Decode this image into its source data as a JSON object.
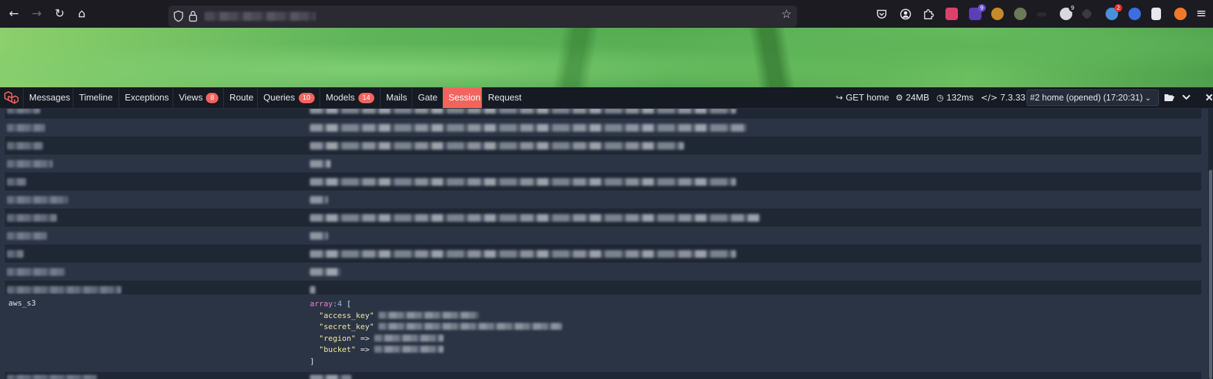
{
  "browser": {
    "back_icon": "←",
    "forward_icon": "→",
    "reload_icon": "↻",
    "home_icon": "⌂",
    "bookmark_icon": "☆",
    "menu_icon": "≡",
    "extension_badges": [
      "9",
      "9",
      "2"
    ]
  },
  "debugbar": {
    "tabs": [
      {
        "label": "Messages"
      },
      {
        "label": "Timeline"
      },
      {
        "label": "Exceptions"
      },
      {
        "label": "Views",
        "badge": "8"
      },
      {
        "label": "Route"
      },
      {
        "label": "Queries",
        "badge": "10"
      },
      {
        "label": "Models",
        "badge": "14"
      },
      {
        "label": "Mails"
      },
      {
        "label": "Gate"
      },
      {
        "label": "Session"
      },
      {
        "label": "Request"
      }
    ],
    "active_tab": "Session",
    "route": "GET home",
    "memory": "24MB",
    "duration": "132ms",
    "php_version": "7.3.33",
    "dataset": "#2 home (opened) (17:20:31)",
    "colors": {
      "accent": "#f4645f",
      "bar_bg": "#161a23",
      "panel_bg": "#2b3444",
      "row_alt": "#1f2634"
    }
  },
  "session": {
    "aws_key": "aws_s3",
    "dump": {
      "type": "array",
      "count": "4",
      "open": "[",
      "close": "]",
      "arrow": "=>",
      "keys": [
        "\"access_key\"",
        "\"secret_key\"",
        "\"region\"",
        "\"bucket\""
      ]
    }
  }
}
